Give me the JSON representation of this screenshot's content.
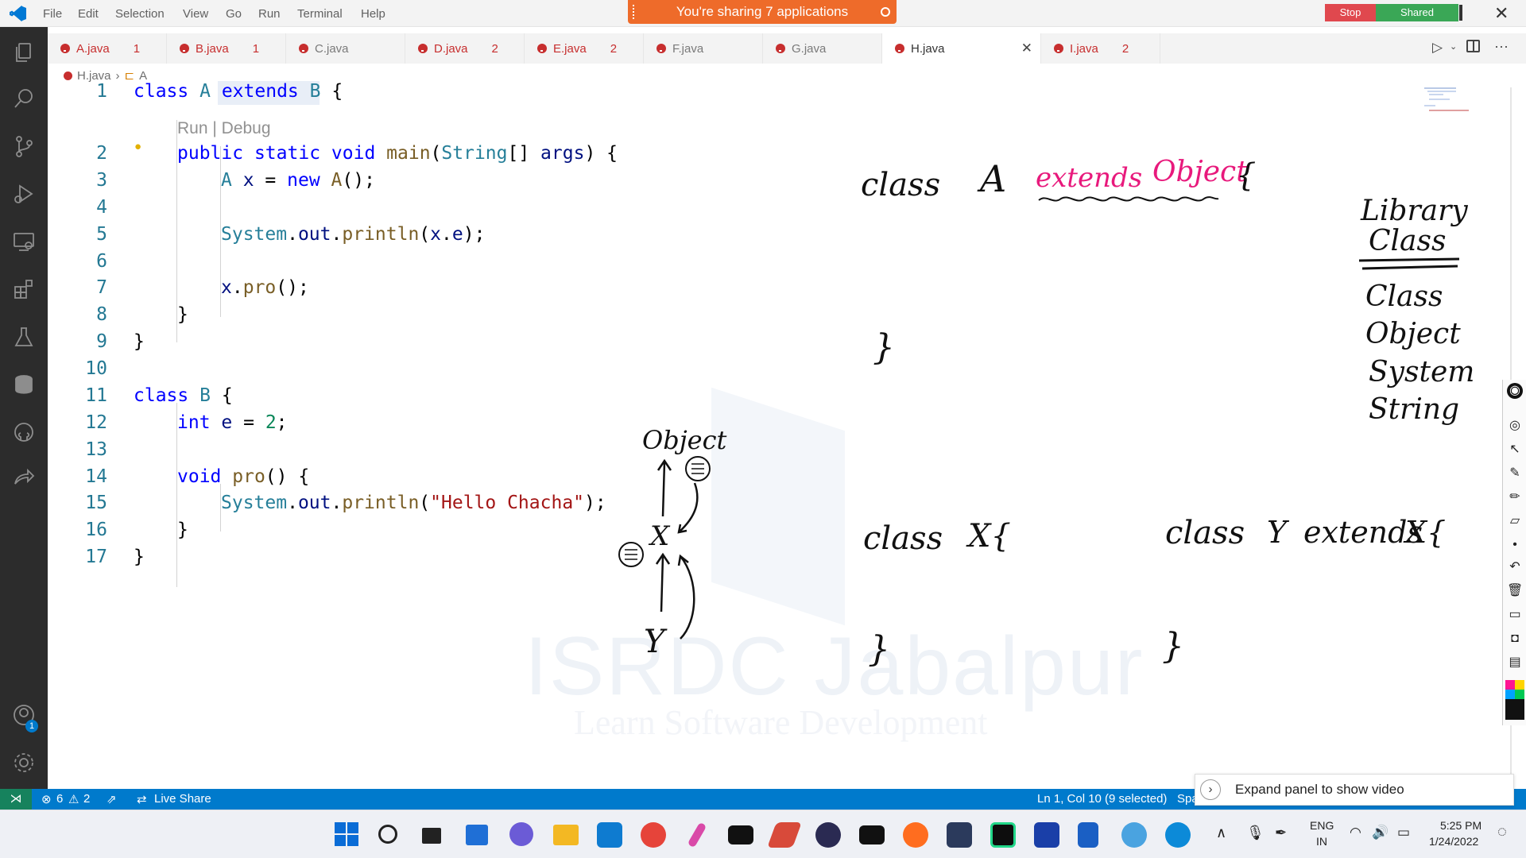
{
  "menu": [
    "File",
    "Edit",
    "Selection",
    "View",
    "Go",
    "Run",
    "Terminal",
    "Help"
  ],
  "sharing": {
    "banner": "You're sharing 7 applications",
    "stop": "Stop",
    "shared": "Shared"
  },
  "tabs": [
    {
      "label": "A.java",
      "count": "1"
    },
    {
      "label": "B.java",
      "count": "1"
    },
    {
      "label": "C.java",
      "count": ""
    },
    {
      "label": "D.java",
      "count": "2"
    },
    {
      "label": "E.java",
      "count": "2"
    },
    {
      "label": "F.java",
      "count": ""
    },
    {
      "label": "G.java",
      "count": ""
    },
    {
      "label": "H.java",
      "count": ""
    },
    {
      "label": "I.java",
      "count": "2"
    }
  ],
  "breadcrumb": {
    "file": "H.java",
    "symbol": "A"
  },
  "code": {
    "line_numbers": [
      "1",
      "2",
      "3",
      "4",
      "5",
      "6",
      "7",
      "8",
      "9",
      "10",
      "11",
      "12",
      "13",
      "14",
      "15",
      "16",
      "17"
    ],
    "codelens": "Run | Debug",
    "lines": {
      "l1a": "class",
      "l1b": "A",
      "l1c": "extends",
      "l1d": "B",
      "l1e": "{",
      "l2a": "public",
      "l2b": "static",
      "l2c": "void",
      "l2d": "main",
      "l2e": "(",
      "l2f": "String",
      "l2g": "[] ",
      "l2h": "args",
      "l2i": ") {",
      "l3a": "A",
      "l3b": "x",
      "l3c": " = ",
      "l3d": "new",
      "l3e": "A",
      "l3f": "();",
      "l5a": "System",
      "l5b": ".",
      "l5c": "out",
      "l5d": ".",
      "l5e": "println",
      "l5f": "(",
      "l5g": "x",
      "l5h": ".",
      "l5i": "e",
      "l5j": ");",
      "l7a": "x",
      "l7b": ".",
      "l7c": "pro",
      "l7d": "();",
      "l8": "}",
      "l9": "}",
      "l11a": "class",
      "l11b": "B",
      "l11c": "{",
      "l12a": "int",
      "l12b": "e",
      "l12c": " = ",
      "l12d": "2",
      "l12e": ";",
      "l14a": "void",
      "l14b": "pro",
      "l14c": "() {",
      "l15a": "System",
      "l15b": ".",
      "l15c": "out",
      "l15d": ".",
      "l15e": "println",
      "l15f": "(",
      "l15g": "\"Hello Chacha\"",
      "l15h": ");",
      "l16": "}",
      "l17": "}"
    }
  },
  "handwriting": {
    "class1": "class",
    "a": "A",
    "extends": "extends",
    "object": "Object",
    "brace_open": "{",
    "brace_close1": "}",
    "library": "Library",
    "class_hdr": "Class",
    "lib_items": [
      "Class",
      "Object",
      "System",
      "String"
    ],
    "diagram_object": "Object",
    "diagram_x": "X",
    "diagram_y": "Y",
    "class2": "class",
    "x_brace": "X{",
    "brace_close2": "}",
    "class3": "class",
    "y": "Y",
    "extends2": "extends",
    "x2_brace": "X{",
    "brace_close3": "}"
  },
  "watermark": {
    "title": "ISRDC Jabalpur",
    "subtitle": "Learn Software Development"
  },
  "status": {
    "errors": "6",
    "warnings": "2",
    "live_share": "Live Share",
    "position": "Ln 1, Col 10 (9 selected)",
    "spaces_fragment": "Spa"
  },
  "video_panel": {
    "text": "Expand panel to show video"
  },
  "tray": {
    "lang1": "ENG",
    "lang2": "IN",
    "time": "5:25 PM",
    "date": "1/24/2022"
  },
  "activity_badge": "1",
  "colors": {
    "accent": "#007acc",
    "share_banner": "#ee6b2a",
    "stop": "#e0484e",
    "shared": "#3aa756",
    "pink_ink": "#e8197c"
  }
}
